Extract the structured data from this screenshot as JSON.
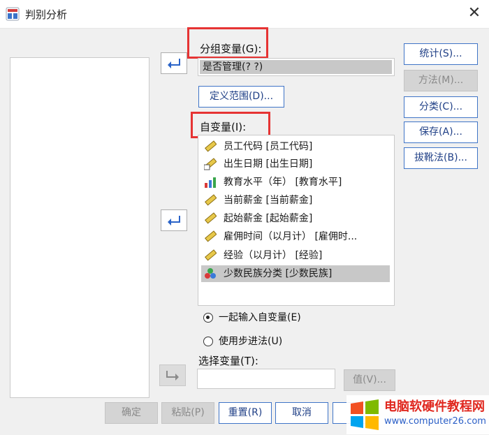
{
  "window": {
    "title": "判别分析",
    "close_glyph": "✕"
  },
  "grouping": {
    "label": "分组变量(G):",
    "value": "是否管理(? ?)",
    "define_range": "定义范围(D)..."
  },
  "independents": {
    "label": "自变量(I):",
    "items": [
      {
        "label": "员工代码 [员工代码]",
        "icon": "ruler-icon"
      },
      {
        "label": "出生日期 [出生日期]",
        "icon": "date-ruler-icon"
      },
      {
        "label": "教育水平（年） [教育水平]",
        "icon": "bar-ordinal-icon"
      },
      {
        "label": "当前薪金 [当前薪金]",
        "icon": "ruler-icon"
      },
      {
        "label": "起始薪金 [起始薪金]",
        "icon": "ruler-icon"
      },
      {
        "label": "雇佣时间（以月计） [雇佣时...",
        "icon": "ruler-icon"
      },
      {
        "label": "经验（以月计） [经验]",
        "icon": "ruler-icon"
      },
      {
        "label": "少数民族分类 [少数民族]",
        "icon": "nominal-circles-icon",
        "selected": true
      }
    ]
  },
  "method_radio": {
    "together": "一起输入自变量(E)",
    "stepwise": "使用步进法(U)",
    "selected": "together"
  },
  "selection": {
    "label": "选择变量(T):",
    "value_button": "值(V)..."
  },
  "side_buttons": {
    "statistics": "统计(S)...",
    "method": "方法(M)...",
    "classify": "分类(C)...",
    "save": "保存(A)...",
    "bootstrap": "拔靴法(B)..."
  },
  "bottom_buttons": {
    "ok": "确定",
    "paste": "粘贴(P)",
    "reset": "重置(R)",
    "cancel": "取消",
    "help": ""
  },
  "watermark": {
    "title": "电脑软硬件教程网",
    "url": "www.computer26.com"
  },
  "colors": {
    "accent_border": "#3f74c7",
    "highlight": "#e63333",
    "arrow": "#2a63c8"
  }
}
